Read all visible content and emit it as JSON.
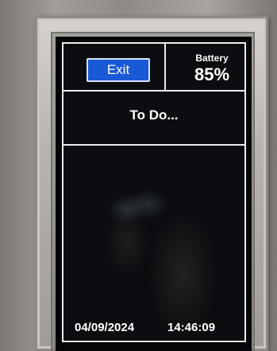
{
  "header": {
    "exit_label": "Exit",
    "battery_label": "Battery",
    "battery_value": "85%"
  },
  "title": "To Do...",
  "footer": {
    "date": "04/09/2024",
    "time": "14:46:09"
  },
  "colors": {
    "button_blue": "#1a59d6",
    "screen_background": "#0b0d10",
    "border": "#e9edf0"
  }
}
